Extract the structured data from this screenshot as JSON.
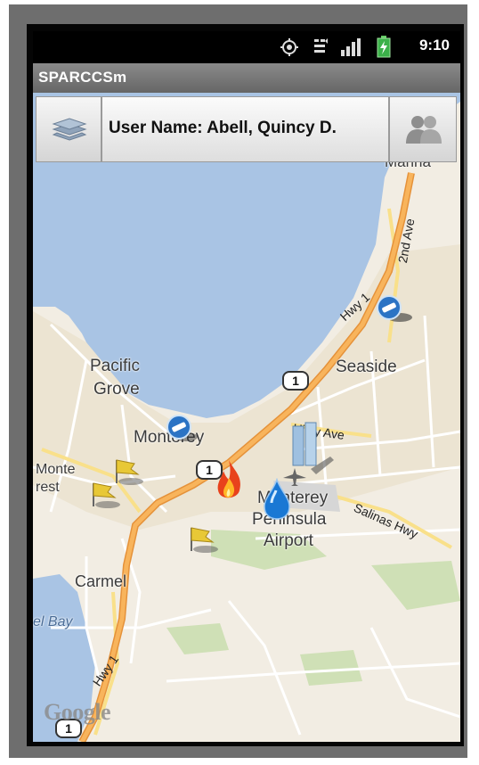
{
  "status_bar": {
    "time": "9:10",
    "icons": [
      "gps-icon",
      "signal-3g-icon",
      "signal-bars-icon",
      "battery-charging-icon"
    ]
  },
  "app": {
    "title": "SPARCCSm"
  },
  "toolbar": {
    "layers_button": "layers-icon",
    "user_label": "User Name: Abell, Quincy D.",
    "group_button": "group-icon"
  },
  "map": {
    "place_labels": {
      "marina": "Marina",
      "pacific": "Pacific",
      "grove": "Grove",
      "seaside": "Seaside",
      "monterey": "Monterey",
      "monte": "Monte",
      "rest": "rest",
      "mp_line1": "Monterey",
      "mp_line2": "Peninsula",
      "mp_line3": "Airport",
      "carmel": "Carmel",
      "bay": "el Bay"
    },
    "road_labels": {
      "hwy1_north": "Hwy 1",
      "second_ave": "2nd Ave",
      "hilby": "Hilby Ave",
      "salinas": "Salinas Hwy",
      "hwy1_south": "Hwy 1"
    },
    "shields": [
      "1",
      "1",
      "1"
    ],
    "attribution": "Google",
    "markers": [
      "police-badge-marker",
      "police-badge-marker",
      "fire-marker",
      "water-drop-marker",
      "yellow-flag-marker",
      "yellow-flag-marker",
      "yellow-flag-marker",
      "building-marker"
    ],
    "colors": {
      "water": "#a9c4e4",
      "land": "#f2ede3",
      "highway": "#f6a84a",
      "park": "#cfe0b6"
    }
  }
}
